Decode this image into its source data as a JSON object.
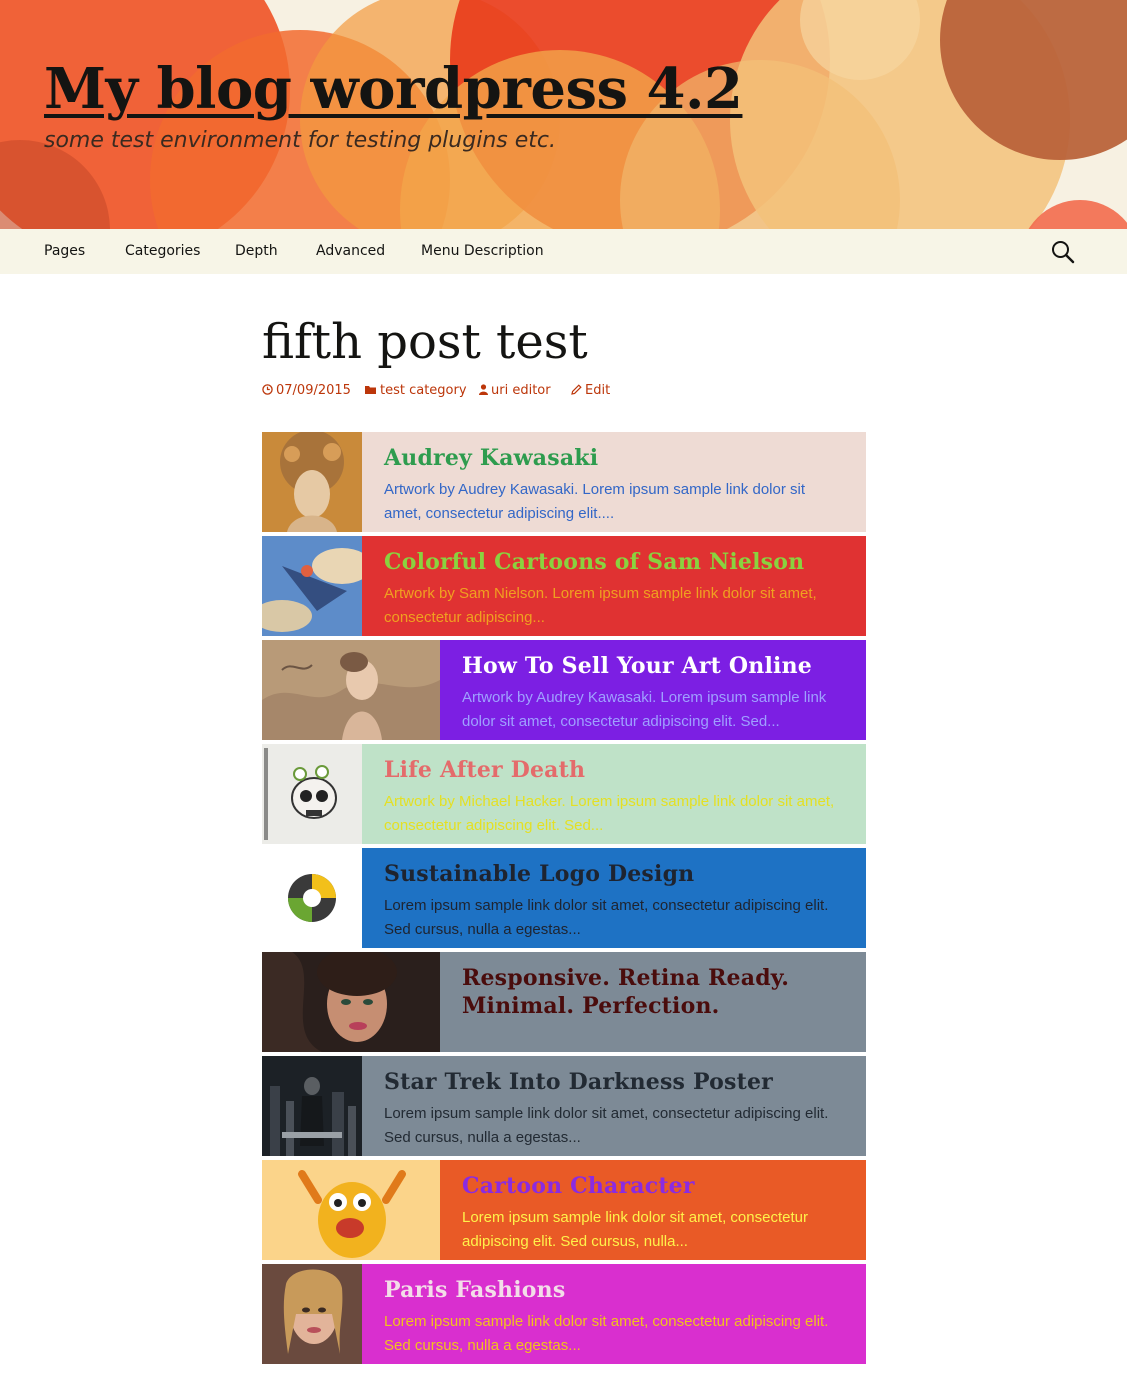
{
  "site": {
    "title": "My blog wordpress 4.2",
    "description": "some test environment for testing plugins etc."
  },
  "nav": {
    "items": [
      {
        "label": "Pages"
      },
      {
        "label": "Categories"
      },
      {
        "label": "Depth"
      },
      {
        "label": "Advanced"
      },
      {
        "label": "Menu Description"
      }
    ],
    "search_icon": "search-icon"
  },
  "post": {
    "title": "fifth post test",
    "meta": {
      "date": "07/09/2015",
      "category": "test category",
      "author": "uri editor",
      "edit": "Edit"
    }
  },
  "colors": {
    "link_accent": "#bc360a",
    "nav_bg": "#f7f5e7"
  },
  "cards": [
    {
      "title": "Audrey Kawasaki",
      "excerpt": "Artwork by Audrey Kawasaki. Lorem ipsum sample link dolor sit amet, consectetur adipiscing elit....",
      "bg": "#eedbd4",
      "title_color": "#2e9c4e",
      "text_color": "#3367c7",
      "thumb": "portrait-painting"
    },
    {
      "title": "Colorful Cartoons of Sam Nielson",
      "excerpt": "Artwork by Sam Nielson. Lorem ipsum sample link dolor sit amet, consectetur adipiscing...",
      "bg": "#e03232",
      "title_color": "#8ad23f",
      "text_color": "#f0a020",
      "thumb": "flying-creature"
    },
    {
      "title": "How To Sell Your Art Online",
      "excerpt": "Artwork by Audrey Kawasaki. Lorem ipsum sample link dolor sit amet, consectetur adipiscing elit. Sed...",
      "bg": "#7c1fe3",
      "title_color": "#ffffff",
      "text_color": "#9fa0ff",
      "thumb": "sketch-woman"
    },
    {
      "title": "Life After Death",
      "excerpt": "Artwork by Michael Hacker. Lorem ipsum sample link dolor sit amet, consectetur adipiscing elit. Sed...",
      "bg": "#bfe2c8",
      "title_color": "#e46b6b",
      "text_color": "#e4e024",
      "thumb": "skull-flowers"
    },
    {
      "title": "Sustainable Logo Design",
      "excerpt": "Lorem ipsum sample link dolor sit amet, consectetur adipiscing elit. Sed cursus, nulla a egestas...",
      "bg": "#1e72c4",
      "title_color": "#1e2430",
      "text_color": "#1e2430",
      "thumb": "recycle-logo"
    },
    {
      "title": "Responsive. Retina Ready. Minimal. Perfection.",
      "excerpt": "",
      "bg": "#7d8a96",
      "title_color": "#4a0c0c",
      "text_color": "#4a0c0c",
      "thumb": "woman-portrait"
    },
    {
      "title": "Star Trek Into Darkness Poster",
      "excerpt": "Lorem ipsum sample link dolor sit amet, consectetur adipiscing elit. Sed cursus, nulla a egestas...",
      "bg": "#7d8a96",
      "title_color": "#222a33",
      "text_color": "#222a33",
      "thumb": "movie-poster"
    },
    {
      "title": "Cartoon Character",
      "excerpt": "Lorem ipsum sample link dolor sit amet, consectetur adipiscing elit. Sed cursus, nulla...",
      "bg": "#e95a26",
      "title_color": "#8a2be2",
      "text_color": "#fff24a",
      "thumb": "yellow-monster"
    },
    {
      "title": "Paris Fashions",
      "excerpt": "Lorem ipsum sample link dolor sit amet, consectetur adipiscing elit. Sed cursus, nulla a egestas...",
      "bg": "#d92fcf",
      "title_color": "#f3dde8",
      "text_color": "#f2c21c",
      "thumb": "fashion-portrait"
    }
  ]
}
